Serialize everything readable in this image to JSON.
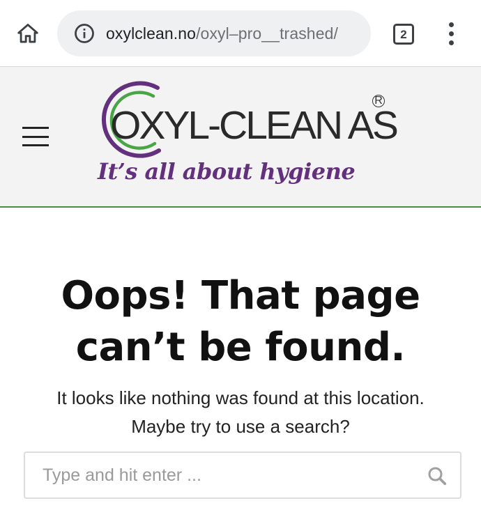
{
  "browser": {
    "url_domain": "oxylclean.no",
    "url_path": "/oxyl–pro__trashed/",
    "tab_count": "2"
  },
  "site": {
    "logo_name": "OXYL-CLEAN AS",
    "logo_reg": "R",
    "tagline": "It’s all about hygiene",
    "colors": {
      "purple": "#63307e",
      "green": "#4a8f3b",
      "header_bg": "#f3f3f3"
    }
  },
  "error": {
    "title": "Oops! That page can’t be found.",
    "message_line1": "It looks like nothing was found at this location.",
    "message_line2": "Maybe try to use a search?"
  },
  "search": {
    "placeholder": "Type and hit enter ...",
    "value": ""
  },
  "icons": {
    "home": "home-icon",
    "info": "info-icon",
    "tabs": "tabs-icon",
    "overflow": "more-vert-icon",
    "menu": "hamburger-menu-icon",
    "search": "search-icon"
  }
}
